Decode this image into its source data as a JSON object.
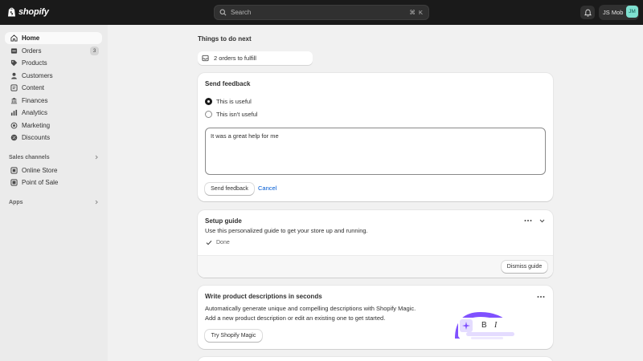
{
  "topbar": {
    "logo_text": "shopify",
    "search_placeholder": "Search",
    "search_shortcut": "⌘ K",
    "store_name": "JS Mob",
    "avatar_initials": "JM"
  },
  "sidebar": {
    "items": [
      {
        "label": "Home",
        "icon": "home-icon",
        "active": true
      },
      {
        "label": "Orders",
        "icon": "orders-icon",
        "badge": "3"
      },
      {
        "label": "Products",
        "icon": "tag-icon"
      },
      {
        "label": "Customers",
        "icon": "person-icon"
      },
      {
        "label": "Content",
        "icon": "content-icon"
      },
      {
        "label": "Finances",
        "icon": "bank-icon"
      },
      {
        "label": "Analytics",
        "icon": "bar-chart-icon"
      },
      {
        "label": "Marketing",
        "icon": "target-icon"
      },
      {
        "label": "Discounts",
        "icon": "discount-icon"
      }
    ],
    "sales_channels_label": "Sales channels",
    "channels": [
      {
        "label": "Online Store",
        "icon": "storefront-icon"
      },
      {
        "label": "Point of Sale",
        "icon": "pos-icon"
      }
    ],
    "apps_label": "Apps"
  },
  "main": {
    "heading": "Things to do next",
    "todo_pill": "2 orders to fulfill",
    "feedback": {
      "title": "Send feedback",
      "option_useful": "This is useful",
      "option_not_useful": "This isn't useful",
      "selected": "useful",
      "textarea_value": "It was a great help for me",
      "send_label": "Send feedback",
      "cancel_label": "Cancel"
    },
    "setup_guide": {
      "title": "Setup guide",
      "description": "Use this personalized guide to get your store up and running.",
      "status": "Done",
      "dismiss_label": "Dismiss guide"
    },
    "magic": {
      "title": "Write product descriptions in seconds",
      "line1": "Automatically generate unique and compelling descriptions with Shopify Magic.",
      "line2": "Add a new product description or edit an existing one to get started.",
      "button_label": "Try Shopify Magic",
      "illus_bold": "B",
      "illus_italic": "I"
    }
  },
  "colors": {
    "topbar_bg": "#1a1a1a",
    "sidebar_bg": "#ebebeb",
    "page_bg": "#f1f1f1",
    "link": "#005bd3",
    "magic_purple": "#8051ff"
  }
}
